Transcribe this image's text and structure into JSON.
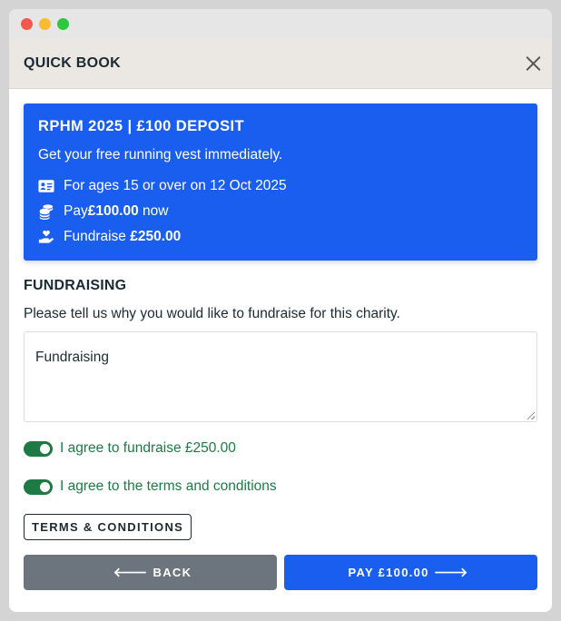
{
  "modal": {
    "title": "QUICK BOOK"
  },
  "event_card": {
    "title": "RPHM 2025 | £100 DEPOSIT",
    "subtitle": "Get your free running vest immediately.",
    "age_text": "For ages 15 or over on 12 Oct 2025",
    "pay_prefix": "Pay ",
    "pay_amount": "£100.00",
    "pay_suffix": " now",
    "fundraise_prefix": "Fundraise ",
    "fundraise_amount": "£250.00",
    "background_color": "#1a5ef0"
  },
  "fundraising": {
    "heading": "FUNDRAISING",
    "prompt": "Please tell us why you would like to fundraise for this charity.",
    "textarea_value": "Fundraising"
  },
  "agreements": {
    "fundraise_label": "I agree to fundraise £250.00",
    "terms_label": "I agree to the terms and conditions",
    "toggle_color": "#1e7a45"
  },
  "buttons": {
    "terms": "TERMS & CONDITIONS",
    "back_arrow": "🡐",
    "back": "BACK",
    "pay": "PAY £100.00",
    "pay_arrow": "🡒"
  },
  "icons": {
    "close": "close-icon",
    "id_card": "id-card-icon",
    "coins": "coins-icon",
    "donate": "hand-holding-heart-icon"
  }
}
